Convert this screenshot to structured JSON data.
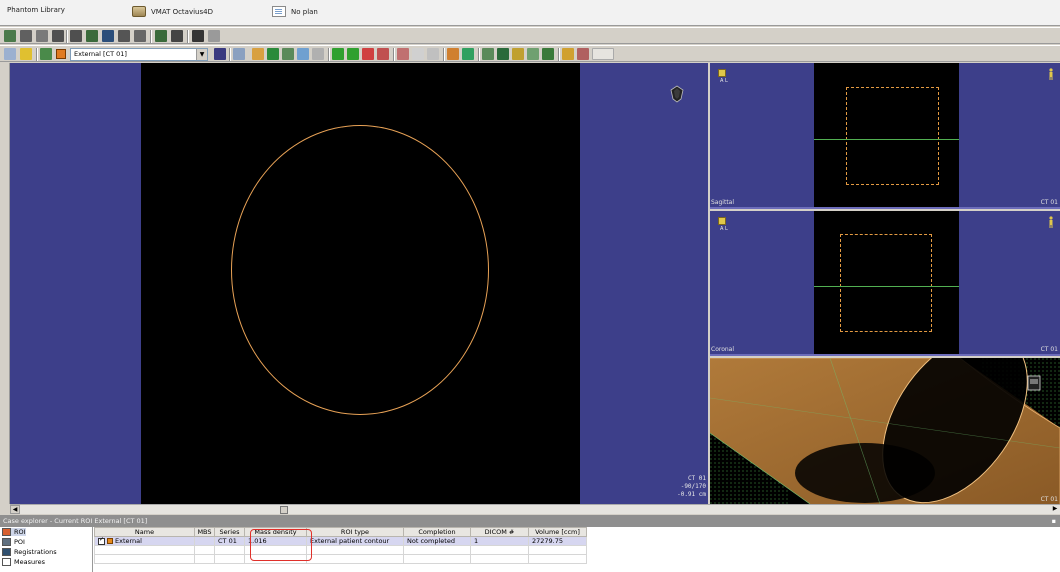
{
  "header": {
    "library": "Phantom Library",
    "case": "VMAT Octavius4D",
    "plan": "No plan"
  },
  "toolbar": {
    "roi_selector": "External [CT 01]",
    "colors": {
      "background": "#d4d0c8",
      "roi_color": "#e07a20"
    }
  },
  "main_view": {
    "series": "CT 01",
    "level": "-90/170",
    "slice": "-0.91 cm"
  },
  "views": {
    "sagittal": {
      "label": "Sagittal",
      "series": "CT 01",
      "orientation": "A L"
    },
    "coronal": {
      "label": "Coronal",
      "series": "CT 01",
      "orientation": "A L"
    },
    "three_d": {
      "series": "CT 01"
    }
  },
  "case_explorer": {
    "title": "Case explorer - Current ROI External [CT 01]",
    "nav": [
      {
        "label": "ROI",
        "icon": "roi-icon"
      },
      {
        "label": "POI",
        "icon": "poi-icon"
      },
      {
        "label": "Registrations",
        "icon": "registrations-icon"
      },
      {
        "label": "Measures",
        "icon": "measures-icon"
      }
    ],
    "columns": [
      "Name",
      "MBS",
      "Series",
      "Mass density",
      "ROI type",
      "Completion",
      "DICOM #",
      "Volume [ccm]"
    ],
    "rows": [
      {
        "name": "External",
        "mbs": "",
        "series": "CT 01",
        "mass_density": "1.016",
        "roi_type": "External patient contour",
        "completion": "Not completed",
        "dicom": "1",
        "volume": "27279.75"
      }
    ]
  }
}
